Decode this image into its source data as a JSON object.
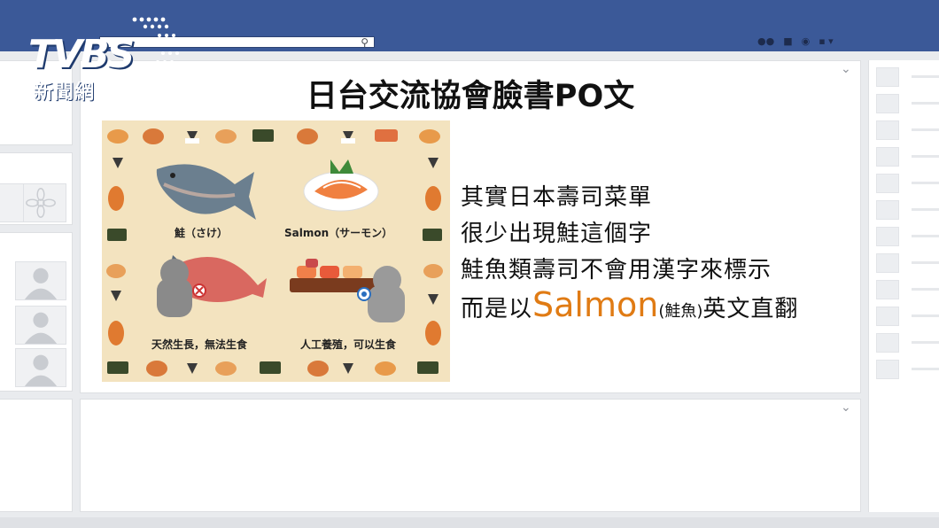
{
  "broadcaster": {
    "logo": "TVBS",
    "logo_sub": "新聞網"
  },
  "post": {
    "title": "日台交流協會臉書PO文",
    "illustration": {
      "caption_top_left": "鮭（さけ）",
      "caption_top_right": "Salmon（サーモン）",
      "caption_bottom_left": "天然生長，無法生食",
      "caption_bottom_right": "人工養殖，可以生食"
    },
    "lines": [
      "其實日本壽司菜單",
      "很少出現鮭這個字",
      "鮭魚類壽司不會用漢字來標示"
    ],
    "last_line": {
      "prefix": "而是以",
      "highlight": "Salmon",
      "paren": "(鮭魚)",
      "suffix": "英文直翻"
    }
  },
  "colors": {
    "fb_blue": "#3b5998",
    "highlight_orange": "#e07b14",
    "illustration_bg": "#f3e3bf"
  }
}
